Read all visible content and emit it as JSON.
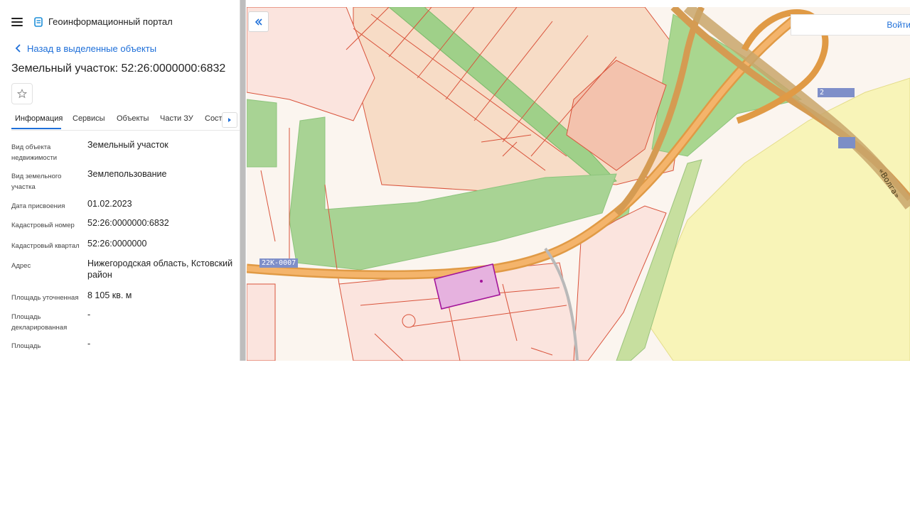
{
  "header": {
    "app_title": "Геоинформационный портал",
    "menu_icon": "hamburger-menu-icon",
    "logo_icon": "portal-logo-icon"
  },
  "nav": {
    "back_label": "Назад в выделенные объекты"
  },
  "object": {
    "title": "Земельный участок: 52:26:0000000:6832"
  },
  "tabs": [
    {
      "label": "Информация",
      "active": true
    },
    {
      "label": "Сервисы"
    },
    {
      "label": "Объекты"
    },
    {
      "label": "Части ЗУ"
    },
    {
      "label": "Состав"
    }
  ],
  "fields": [
    {
      "label": "Вид объекта недвижимости",
      "value": "Земельный участок"
    },
    {
      "label": "Вид земельного участка",
      "value": "Землепользование"
    },
    {
      "label": "Дата присвоения",
      "value": "01.02.2023"
    },
    {
      "label": "Кадастровый номер",
      "value": "52:26:0000000:6832"
    },
    {
      "label": "Кадастровый квартал",
      "value": "52:26:0000000"
    },
    {
      "label": "Адрес",
      "value": "Нижегородская область, Кстовский район"
    },
    {
      "label": "Площадь уточненная",
      "value": "8 105 кв. м"
    },
    {
      "label": "Площадь декларированная",
      "value": "-"
    },
    {
      "label": "Площадь",
      "value": "-"
    }
  ],
  "map": {
    "login_label": "Войти",
    "road_label_1": "22К-0007",
    "road_label_2": "2",
    "road_name": "«Волга»",
    "colors": {
      "parcel_fill": "#f9ddd5",
      "parcel_stroke": "#d9533b",
      "green": "#9fd089",
      "road": "#f0a24e",
      "yellow": "#f8f4b8",
      "selected": "#e6b2df"
    }
  }
}
